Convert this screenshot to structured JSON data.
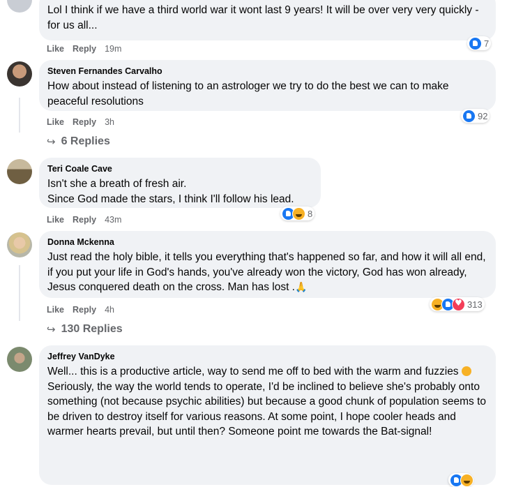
{
  "comments": [
    {
      "author": "",
      "text": "Lol I think if we have a third world war it wont last 9 years! It will be over very very quickly - for us all...",
      "like": "Like",
      "reply": "Reply",
      "time": "19m",
      "reaction_count": "7",
      "reactions": [
        "like-icon"
      ]
    },
    {
      "author": "Steven Fernandes Carvalho",
      "text": "How about instead of listening to an astrologer we try to do the best we can to make peaceful resolutions",
      "like": "Like",
      "reply": "Reply",
      "time": "3h",
      "reaction_count": "92",
      "reactions": [
        "like-icon"
      ],
      "replies": "6 Replies"
    },
    {
      "author": "Teri Coale Cave",
      "text_lines": [
        "Isn't she a breath of fresh air.",
        "Since God made the stars, I think I'll follow his lead."
      ],
      "like": "Like",
      "reply": "Reply",
      "time": "43m",
      "reaction_count": "8",
      "reactions": [
        "like-icon",
        "haha-icon"
      ]
    },
    {
      "author": "Donna Mckenna",
      "text": "Just read the holy bible, it tells you everything that's happened so far, and how it will all end, if you put your life in God's hands, you've already won the victory, God has won already, Jesus conquered death on the cross. Man has lost .",
      "emoji": "🙏",
      "like": "Like",
      "reply": "Reply",
      "time": "4h",
      "reaction_count": "313",
      "reactions": [
        "haha-icon",
        "like-icon",
        "love-icon"
      ],
      "replies": "130 Replies"
    },
    {
      "author": "Jeffrey VanDyke",
      "text_a": "Well... this is a productive article, way to send me off to bed with the warm and fuzzies",
      "text_b": "Seriously, the way the world tends to operate, I'd be inclined to believe she's probably onto something (not because psychic abilities) but because a good chunk of population seems to be driven to destroy itself for various reasons. At some point, I hope cooler heads and warmer hearts prevail, but until then? Someone point me towards the Bat-signal!"
    }
  ]
}
